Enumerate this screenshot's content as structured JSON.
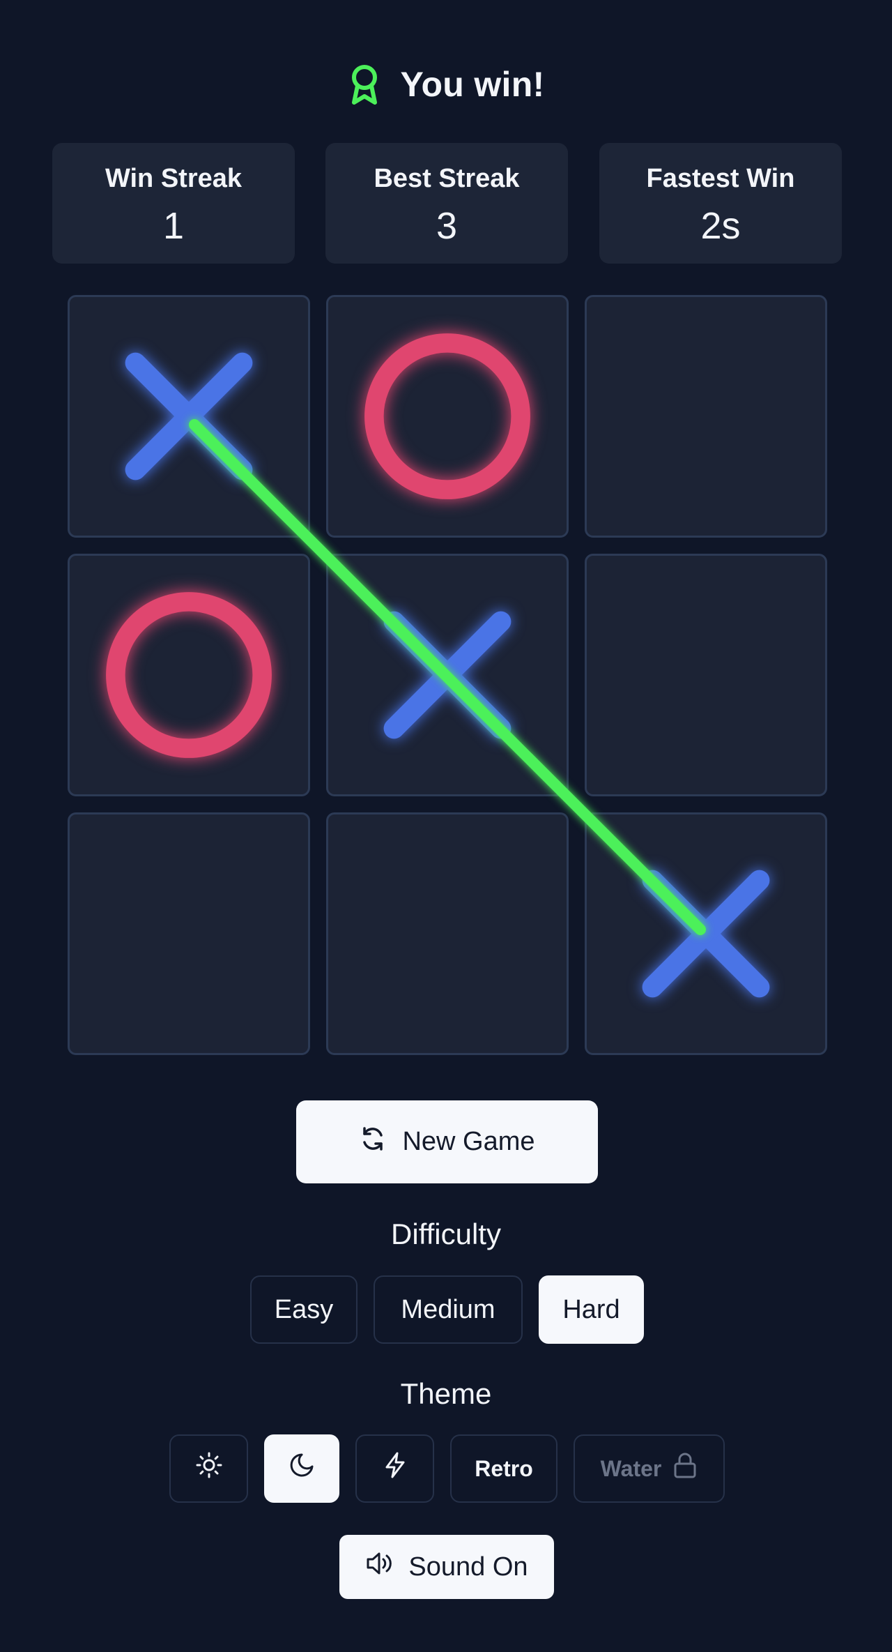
{
  "status": {
    "text": "You win!",
    "icon": "award-icon",
    "icon_color": "#4cf05a"
  },
  "stats": [
    {
      "label": "Win Streak",
      "value": "1"
    },
    {
      "label": "Best Streak",
      "value": "3"
    },
    {
      "label": "Fastest Win",
      "value": "2s"
    }
  ],
  "board": {
    "cells": [
      "X",
      "O",
      "",
      "O",
      "X",
      "",
      "",
      "",
      "X"
    ],
    "winning_line": [
      0,
      4,
      8
    ],
    "colors": {
      "x": "#4a74e6",
      "o": "#e0466f",
      "win_line": "#4cf05a"
    }
  },
  "new_game": {
    "label": "New Game",
    "icon": "refresh-icon"
  },
  "difficulty": {
    "title": "Difficulty",
    "options": [
      "Easy",
      "Medium",
      "Hard"
    ],
    "selected": "Hard"
  },
  "theme": {
    "title": "Theme",
    "options": [
      {
        "icon": "sun-icon"
      },
      {
        "icon": "moon-icon",
        "selected": true
      },
      {
        "icon": "lightning-icon"
      },
      {
        "label": "Retro"
      },
      {
        "label": "Water",
        "locked": true,
        "icon": "lock-icon"
      }
    ]
  },
  "sound": {
    "label": "Sound On",
    "icon": "speaker-icon"
  }
}
